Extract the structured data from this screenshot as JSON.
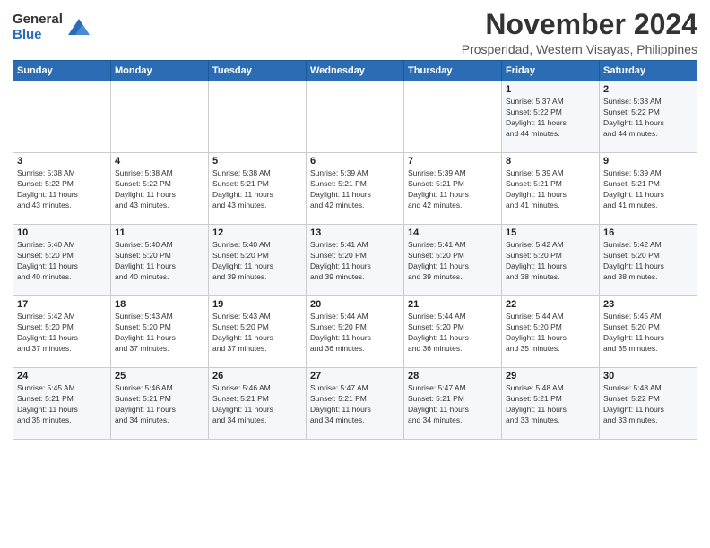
{
  "logo": {
    "general": "General",
    "blue": "Blue"
  },
  "header": {
    "month": "November 2024",
    "location": "Prosperidad, Western Visayas, Philippines"
  },
  "weekdays": [
    "Sunday",
    "Monday",
    "Tuesday",
    "Wednesday",
    "Thursday",
    "Friday",
    "Saturday"
  ],
  "weeks": [
    [
      {
        "day": "",
        "info": ""
      },
      {
        "day": "",
        "info": ""
      },
      {
        "day": "",
        "info": ""
      },
      {
        "day": "",
        "info": ""
      },
      {
        "day": "",
        "info": ""
      },
      {
        "day": "1",
        "info": "Sunrise: 5:37 AM\nSunset: 5:22 PM\nDaylight: 11 hours\nand 44 minutes."
      },
      {
        "day": "2",
        "info": "Sunrise: 5:38 AM\nSunset: 5:22 PM\nDaylight: 11 hours\nand 44 minutes."
      }
    ],
    [
      {
        "day": "3",
        "info": "Sunrise: 5:38 AM\nSunset: 5:22 PM\nDaylight: 11 hours\nand 43 minutes."
      },
      {
        "day": "4",
        "info": "Sunrise: 5:38 AM\nSunset: 5:22 PM\nDaylight: 11 hours\nand 43 minutes."
      },
      {
        "day": "5",
        "info": "Sunrise: 5:38 AM\nSunset: 5:21 PM\nDaylight: 11 hours\nand 43 minutes."
      },
      {
        "day": "6",
        "info": "Sunrise: 5:39 AM\nSunset: 5:21 PM\nDaylight: 11 hours\nand 42 minutes."
      },
      {
        "day": "7",
        "info": "Sunrise: 5:39 AM\nSunset: 5:21 PM\nDaylight: 11 hours\nand 42 minutes."
      },
      {
        "day": "8",
        "info": "Sunrise: 5:39 AM\nSunset: 5:21 PM\nDaylight: 11 hours\nand 41 minutes."
      },
      {
        "day": "9",
        "info": "Sunrise: 5:39 AM\nSunset: 5:21 PM\nDaylight: 11 hours\nand 41 minutes."
      }
    ],
    [
      {
        "day": "10",
        "info": "Sunrise: 5:40 AM\nSunset: 5:20 PM\nDaylight: 11 hours\nand 40 minutes."
      },
      {
        "day": "11",
        "info": "Sunrise: 5:40 AM\nSunset: 5:20 PM\nDaylight: 11 hours\nand 40 minutes."
      },
      {
        "day": "12",
        "info": "Sunrise: 5:40 AM\nSunset: 5:20 PM\nDaylight: 11 hours\nand 39 minutes."
      },
      {
        "day": "13",
        "info": "Sunrise: 5:41 AM\nSunset: 5:20 PM\nDaylight: 11 hours\nand 39 minutes."
      },
      {
        "day": "14",
        "info": "Sunrise: 5:41 AM\nSunset: 5:20 PM\nDaylight: 11 hours\nand 39 minutes."
      },
      {
        "day": "15",
        "info": "Sunrise: 5:42 AM\nSunset: 5:20 PM\nDaylight: 11 hours\nand 38 minutes."
      },
      {
        "day": "16",
        "info": "Sunrise: 5:42 AM\nSunset: 5:20 PM\nDaylight: 11 hours\nand 38 minutes."
      }
    ],
    [
      {
        "day": "17",
        "info": "Sunrise: 5:42 AM\nSunset: 5:20 PM\nDaylight: 11 hours\nand 37 minutes."
      },
      {
        "day": "18",
        "info": "Sunrise: 5:43 AM\nSunset: 5:20 PM\nDaylight: 11 hours\nand 37 minutes."
      },
      {
        "day": "19",
        "info": "Sunrise: 5:43 AM\nSunset: 5:20 PM\nDaylight: 11 hours\nand 37 minutes."
      },
      {
        "day": "20",
        "info": "Sunrise: 5:44 AM\nSunset: 5:20 PM\nDaylight: 11 hours\nand 36 minutes."
      },
      {
        "day": "21",
        "info": "Sunrise: 5:44 AM\nSunset: 5:20 PM\nDaylight: 11 hours\nand 36 minutes."
      },
      {
        "day": "22",
        "info": "Sunrise: 5:44 AM\nSunset: 5:20 PM\nDaylight: 11 hours\nand 35 minutes."
      },
      {
        "day": "23",
        "info": "Sunrise: 5:45 AM\nSunset: 5:20 PM\nDaylight: 11 hours\nand 35 minutes."
      }
    ],
    [
      {
        "day": "24",
        "info": "Sunrise: 5:45 AM\nSunset: 5:21 PM\nDaylight: 11 hours\nand 35 minutes."
      },
      {
        "day": "25",
        "info": "Sunrise: 5:46 AM\nSunset: 5:21 PM\nDaylight: 11 hours\nand 34 minutes."
      },
      {
        "day": "26",
        "info": "Sunrise: 5:46 AM\nSunset: 5:21 PM\nDaylight: 11 hours\nand 34 minutes."
      },
      {
        "day": "27",
        "info": "Sunrise: 5:47 AM\nSunset: 5:21 PM\nDaylight: 11 hours\nand 34 minutes."
      },
      {
        "day": "28",
        "info": "Sunrise: 5:47 AM\nSunset: 5:21 PM\nDaylight: 11 hours\nand 34 minutes."
      },
      {
        "day": "29",
        "info": "Sunrise: 5:48 AM\nSunset: 5:21 PM\nDaylight: 11 hours\nand 33 minutes."
      },
      {
        "day": "30",
        "info": "Sunrise: 5:48 AM\nSunset: 5:22 PM\nDaylight: 11 hours\nand 33 minutes."
      }
    ]
  ]
}
